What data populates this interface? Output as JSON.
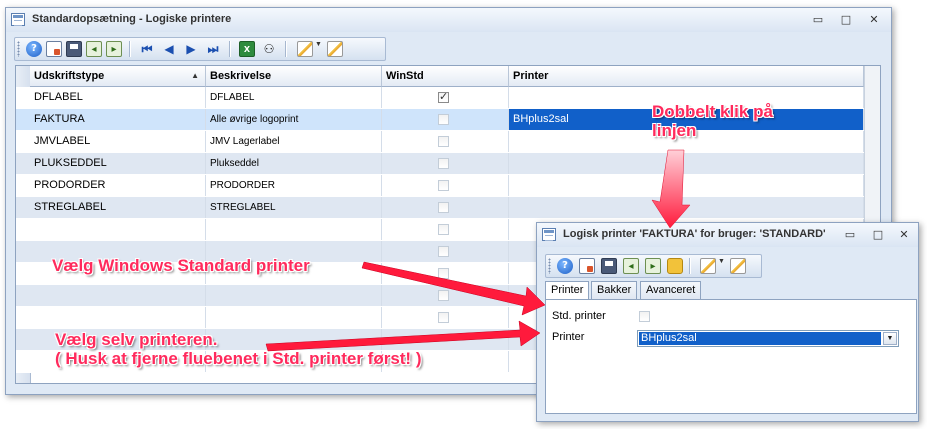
{
  "main_window": {
    "title": "Standardopsætning - Logiske printere",
    "controls": {
      "minimize": "▭",
      "maximize": "□",
      "close": "✕"
    },
    "toolbar": [
      "help-icon",
      "new-document-icon",
      "save-icon",
      "arrow-left-box-icon",
      "arrow-right-box-icon",
      "first-record-icon",
      "previous-record-icon",
      "next-record-icon",
      "last-record-icon",
      "excel-export-icon",
      "binoculars-icon",
      "edit-pencil-icon",
      "edit-pencil-2-icon"
    ],
    "grid": {
      "columns": [
        "Udskriftstype",
        "Beskrivelse",
        "WinStd",
        "Printer"
      ],
      "sort_indicator": "▲",
      "rows": [
        {
          "type": "DFLABEL",
          "description": "DFLABEL",
          "winstd": true,
          "printer": ""
        },
        {
          "type": "FAKTURA",
          "description": "Alle øvrige logoprint",
          "winstd": false,
          "printer": "BHplus2sal"
        },
        {
          "type": "JMVLABEL",
          "description": "JMV Lagerlabel",
          "winstd": false,
          "printer": ""
        },
        {
          "type": "PLUKSEDDEL",
          "description": "Plukseddel",
          "winstd": false,
          "printer": ""
        },
        {
          "type": "PRODORDER",
          "description": "PRODORDER",
          "winstd": false,
          "printer": ""
        },
        {
          "type": "STREGLABEL",
          "description": "STREGLABEL",
          "winstd": false,
          "printer": ""
        }
      ],
      "selected_row": 1
    }
  },
  "dialog": {
    "title": "Logisk printer 'FAKTURA' for bruger: 'STANDARD'",
    "tabs": [
      "Printer",
      "Bakker",
      "Avanceret"
    ],
    "active_tab": "Printer",
    "std_printer_label": "Std. printer",
    "std_printer_checked": false,
    "printer_label": "Printer",
    "printer_value": "BHplus2sal",
    "combo_arrow": "▼"
  },
  "annotations": {
    "double_click": [
      "Dobbelt klik på",
      "linjen"
    ],
    "choose_windows": "Vælg Windows Standard printer",
    "choose_self": [
      "Vælg selv printeren.",
      "( Husk at fjerne fluebenet i Std. printer først! )"
    ],
    "color": "#ff2a5c"
  }
}
